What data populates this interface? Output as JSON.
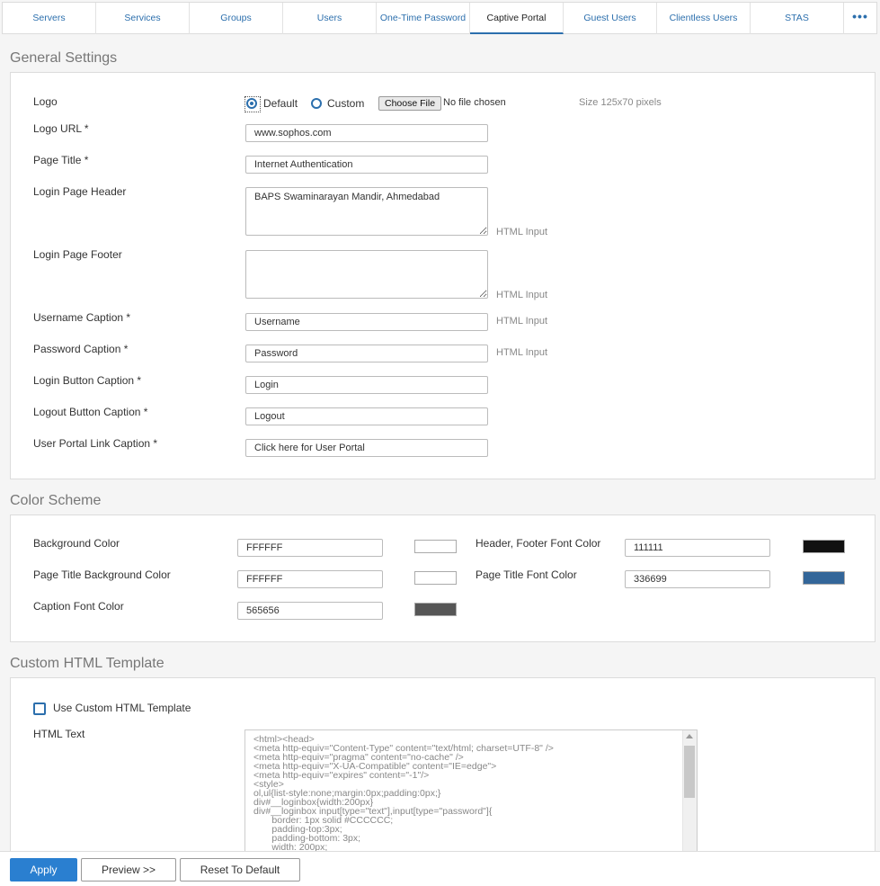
{
  "tabs": [
    {
      "label": "Servers"
    },
    {
      "label": "Services"
    },
    {
      "label": "Groups"
    },
    {
      "label": "Users"
    },
    {
      "label": "One-Time Password"
    },
    {
      "label": "Captive Portal",
      "active": true
    },
    {
      "label": "Guest Users"
    },
    {
      "label": "Clientless Users"
    },
    {
      "label": "STAS"
    },
    {
      "label": "•••"
    }
  ],
  "general": {
    "title": "General Settings",
    "logo": {
      "label": "Logo",
      "default_label": "Default",
      "custom_label": "Custom",
      "selected": "Default",
      "choose_file": "Choose File",
      "no_file": "No file chosen",
      "size_hint": "Size 125x70 pixels"
    },
    "logo_url": {
      "label": "Logo URL *",
      "value": "www.sophos.com"
    },
    "page_title": {
      "label": "Page Title *",
      "value": "Internet Authentication"
    },
    "login_header": {
      "label": "Login Page Header",
      "value": "BAPS Swaminarayan Mandir, Ahmedabad",
      "hint": "HTML Input"
    },
    "login_footer": {
      "label": "Login Page Footer",
      "value": "",
      "hint": "HTML Input"
    },
    "username_caption": {
      "label": "Username Caption *",
      "value": "Username",
      "hint": "HTML Input"
    },
    "password_caption": {
      "label": "Password Caption *",
      "value": "Password",
      "hint": "HTML Input"
    },
    "login_button_caption": {
      "label": "Login Button Caption *",
      "value": "Login"
    },
    "logout_button_caption": {
      "label": "Logout Button Caption *",
      "value": "Logout"
    },
    "user_portal_link_caption": {
      "label": "User Portal Link Caption *",
      "value": "Click here for User Portal"
    }
  },
  "colors": {
    "title": "Color Scheme",
    "background": {
      "label": "Background Color",
      "value": "FFFFFF",
      "swatch": "#FFFFFF"
    },
    "page_title_bg": {
      "label": "Page Title Background Color",
      "value": "FFFFFF",
      "swatch": "#FFFFFF"
    },
    "caption_font": {
      "label": "Caption Font Color",
      "value": "565656",
      "swatch": "#565656"
    },
    "header_footer_font": {
      "label": "Header, Footer Font Color",
      "value": "111111",
      "swatch": "#111111"
    },
    "page_title_font": {
      "label": "Page Title Font Color",
      "value": "336699",
      "swatch": "#336699"
    }
  },
  "custom_html": {
    "title": "Custom HTML Template",
    "use_label": "Use Custom HTML Template",
    "use_checked": false,
    "html_text_label": "HTML Text",
    "html_text": "<html><head>\n<meta http-equiv=\"Content-Type\" content=\"text/html; charset=UTF-8\" />\n<meta http-equiv=\"pragma\" content=\"no-cache\" />\n<meta http-equiv=\"X-UA-Compatible\" content=\"IE=edge\">\n<meta http-equiv=\"expires\" content=\"-1\"/>\n<style>\nol,ul{list-style:none;margin:0px;padding:0px;}\ndiv#__loginbox{width:200px}\ndiv#__loginbox input[type=\"text\"],input[type=\"password\"]{\n       border: 1px solid #CCCCCC;\n       padding-top:3px;\n       padding-bottom: 3px;\n       width: 200px;"
  },
  "footer": {
    "apply": "Apply",
    "preview": "Preview >>",
    "reset": "Reset To Default"
  },
  "theme": {
    "accent": "#2a7fd0",
    "tab_text": "#2c6fad"
  }
}
